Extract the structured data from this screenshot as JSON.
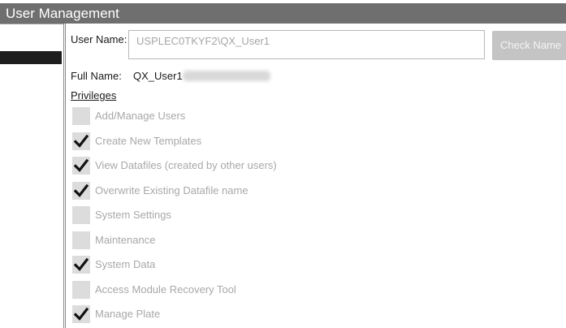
{
  "window": {
    "title": "User Management"
  },
  "form": {
    "username_label": "User Name:",
    "username_value": "USPLEC0TKYF2\\QX_User1",
    "check_name_label": "Check Name",
    "fullname_label": "Full Name:",
    "fullname_value": "QX_User1",
    "privileges_heading": "Privileges"
  },
  "privileges": [
    {
      "label": "Add/Manage Users",
      "checked": false
    },
    {
      "label": "Create New Templates",
      "checked": true
    },
    {
      "label": "View Datafiles (created by other users)",
      "checked": true
    },
    {
      "label": "Overwrite Existing Datafile name",
      "checked": true
    },
    {
      "label": "System Settings",
      "checked": false
    },
    {
      "label": "Maintenance",
      "checked": false
    },
    {
      "label": "System Data",
      "checked": true
    },
    {
      "label": "Access Module Recovery Tool",
      "checked": false
    },
    {
      "label": "Manage Plate",
      "checked": true
    }
  ],
  "colors": {
    "titlebar": "#6f6f6f",
    "checkbox_bg": "#dcdcdc",
    "disabled_text": "#a8a8a8",
    "check_mark": "#111111"
  }
}
